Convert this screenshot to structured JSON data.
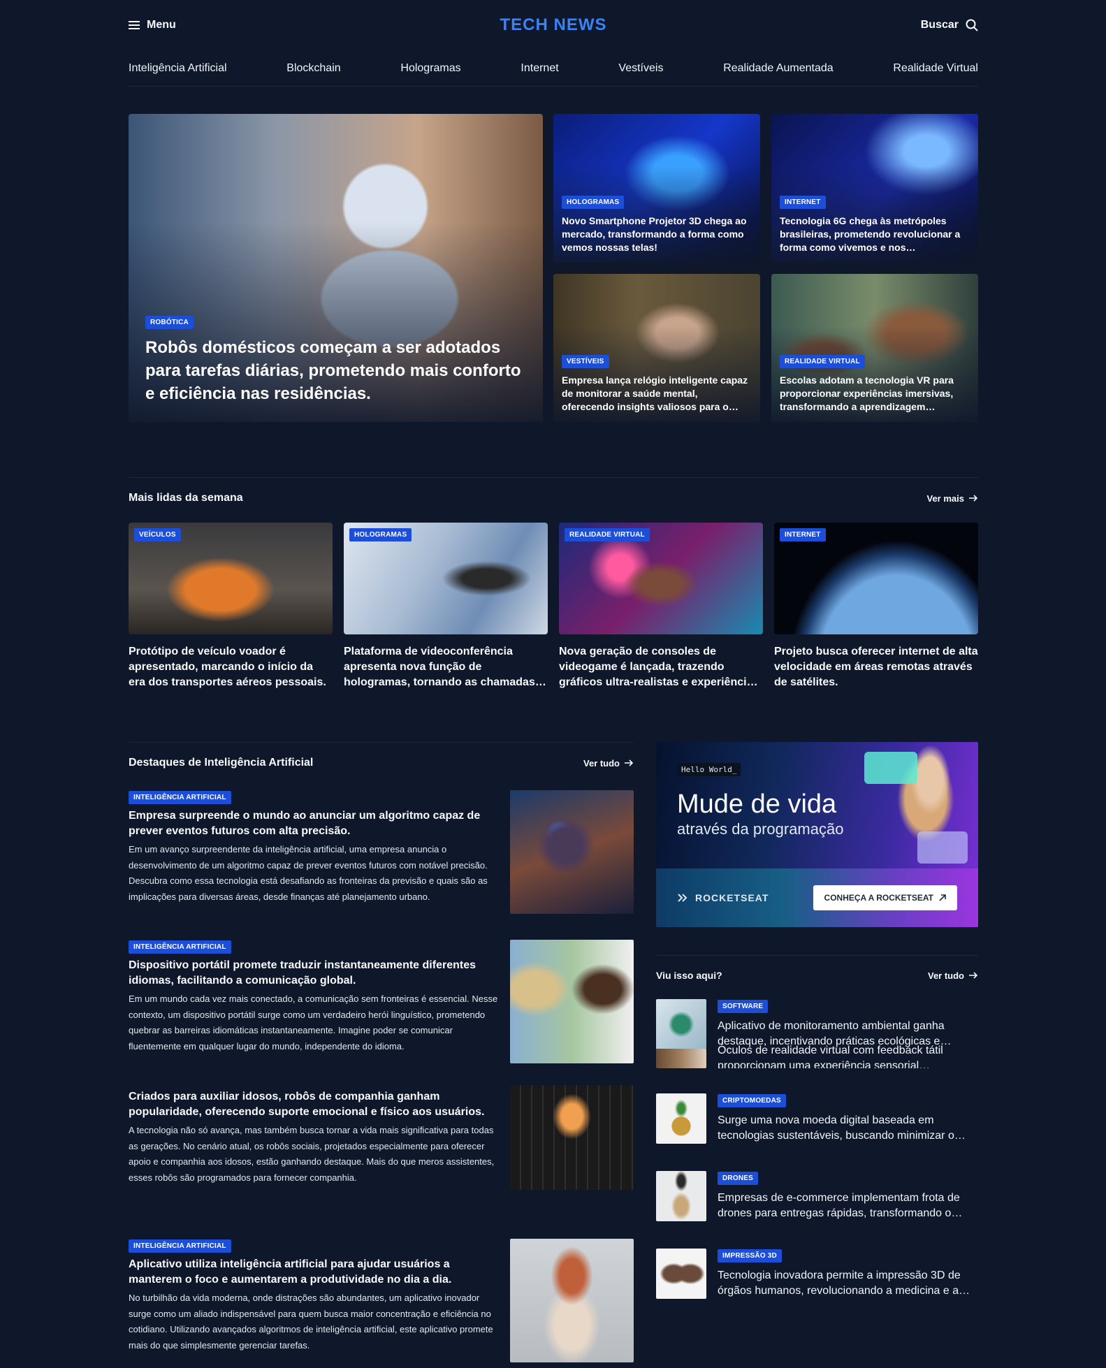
{
  "header": {
    "menu_label": "Menu",
    "logo": "TECH NEWS",
    "search_label": "Buscar"
  },
  "categories": [
    "Inteligência Artificial",
    "Blockchain",
    "Hologramas",
    "Internet",
    "Vestíveis",
    "Realidade Aumentada",
    "Realidade Virtual"
  ],
  "hero": {
    "main": {
      "tag": "ROBÓTICA",
      "title": "Robôs domésticos começam a ser adotados para tarefas diárias, prometendo mais conforto e eficiência nas residências."
    },
    "cards": [
      {
        "tag": "HOLOGRAMAS",
        "title": "Novo Smartphone Projetor 3D chega ao mercado, transformando a forma como vemos nossas telas!"
      },
      {
        "tag": "INTERNET",
        "title": "Tecnologia 6G chega às metrópoles brasileiras, prometendo revolucionar a forma como vivemos e nos comunicamos."
      },
      {
        "tag": "VESTÍVEIS",
        "title": "Empresa lança relógio inteligente capaz de monitorar a saúde mental, oferecendo insights valiosos para o bem-estar."
      },
      {
        "tag": "REALIDADE VIRTUAL",
        "title": "Escolas adotam a tecnologia VR para proporcionar experiências imersivas, transformando a aprendizagem tradicional."
      }
    ]
  },
  "most_read": {
    "title": "Mais lidas da semana",
    "link": "Ver mais",
    "items": [
      {
        "tag": "VEÍCULOS",
        "title": "Protótipo de veículo voador é apresentado, marcando o início da era dos transportes aéreos pessoais."
      },
      {
        "tag": "HOLOGRAMAS",
        "title": "Plataforma de videoconferência apresenta nova função de hologramas, tornando as chamadas mais reais."
      },
      {
        "tag": "REALIDADE VIRTUAL",
        "title": "Nova geração de consoles de videogame é lançada, trazendo gráficos ultra-realistas e experiências únicas."
      },
      {
        "tag": "INTERNET",
        "title": "Projeto busca oferecer internet de alta velocidade em áreas remotas através de satélites."
      }
    ]
  },
  "ai_highlights": {
    "title": "Destaques de Inteligência Artificial",
    "link": "Ver tudo",
    "items": [
      {
        "tag": "INTELIGÊNCIA ARTIFICIAL",
        "title": "Empresa surpreende o mundo ao anunciar um algoritmo capaz de prever eventos futuros com alta precisão.",
        "text": "Em um avanço surpreendente da inteligência artificial, uma empresa anuncia o desenvolvimento de um algoritmo capaz de prever eventos futuros com notável precisão. Descubra como essa tecnologia está desafiando as fronteiras da previsão e quais são as implicações para diversas áreas, desde finanças até planejamento urbano."
      },
      {
        "tag": "INTELIGÊNCIA ARTIFICIAL",
        "title": "Dispositivo portátil promete traduzir instantaneamente diferentes idiomas, facilitando a comunicação global.",
        "text": "Em um mundo cada vez mais conectado, a comunicação sem fronteiras é essencial. Nesse contexto, um dispositivo portátil surge como um verdadeiro herói linguístico, prometendo quebrar as barreiras idiomáticas instantaneamente. Imagine poder se comunicar fluentemente em qualquer lugar do mundo, independente do idioma."
      },
      {
        "tag": "",
        "title": "Criados para auxiliar idosos, robôs de companhia ganham popularidade, oferecendo suporte emocional e físico aos usuários.",
        "text": "A tecnologia não só avança, mas também busca tornar a vida mais significativa para todas as gerações. No cenário atual, os robôs sociais, projetados especialmente para oferecer apoio e companhia aos idosos, estão ganhando destaque. Mais do que meros assistentes, esses robôs são programados para fornecer companhia."
      },
      {
        "tag": "INTELIGÊNCIA ARTIFICIAL",
        "title": "Aplicativo utiliza inteligência artificial para ajudar usuários a manterem o foco e aumentarem a produtividade no dia a dia.",
        "text": "No turbilhão da vida moderna, onde distrações são abundantes, um aplicativo inovador surge como um aliado indispensável para quem busca maior concentração e eficiência no cotidiano. Utilizando avançados algoritmos de inteligência artificial, este aplicativo promete mais do que simplesmente gerenciar tarefas."
      }
    ]
  },
  "ad": {
    "hello": "Hello World_",
    "headline": "Mude de vida",
    "subheadline": "através da programação",
    "brand": "ROCKETSEAT",
    "cta": "CONHEÇA A ROCKETSEAT"
  },
  "seen": {
    "title": "Viu isso aqui?",
    "link": "Ver tudo",
    "items": [
      {
        "tag": "SOFTWARE",
        "title": "Aplicativo de monitoramento ambiental ganha destaque, incentivando práticas ecológicas e promovendo a sustentabilidade."
      },
      {
        "tag": "",
        "title": "Óculos de realidade virtual com feedback tátil proporcionam uma experiência sensorial completamente nova."
      },
      {
        "tag": "CRIPTOMOEDAS",
        "title": "Surge uma nova moeda digital baseada em tecnologias sustentáveis, buscando minimizar o impacto ambiental."
      },
      {
        "tag": "DRONES",
        "title": "Empresas de e-commerce implementam frota de drones para entregas rápidas, transformando o comércio."
      },
      {
        "tag": "IMPRESSÃO 3D",
        "title": "Tecnologia inovadora permite a impressão 3D de órgãos humanos, revolucionando a medicina e a liberdade."
      }
    ]
  },
  "colors": {
    "background": "#0f172a",
    "accent": "#3b82f6",
    "badge": "#1d4ed8"
  }
}
